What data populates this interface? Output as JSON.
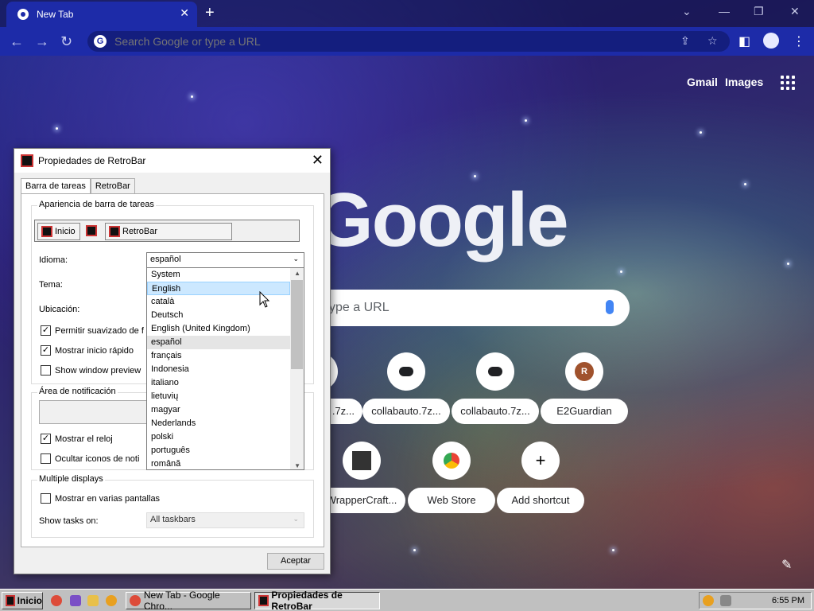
{
  "browser": {
    "tab_title": "New Tab",
    "omnibox_placeholder": "Search Google or type a URL",
    "links": {
      "gmail": "Gmail",
      "images": "Images"
    },
    "logo_text": "Google",
    "search_placeholder": "ype a URL",
    "shortcuts": [
      {
        "label": ".7z...",
        "icon": "cloud-upload-icon"
      },
      {
        "label": "collabauto.7z...",
        "icon": "cloud-upload-icon"
      },
      {
        "label": "collabauto.7z...",
        "icon": "cloud-upload-icon"
      },
      {
        "label": "E2Guardian",
        "icon": "avatar-r",
        "letter": "R"
      },
      {
        "label": "WrapperCraft...",
        "icon": "wrappercraft-icon"
      },
      {
        "label": "Web Store",
        "icon": "webstore-icon"
      },
      {
        "label": "Add shortcut",
        "icon": "plus-icon"
      }
    ]
  },
  "dialog": {
    "title": "Propiedades de RetroBar",
    "tabs": [
      "Barra de tareas",
      "RetroBar"
    ],
    "appearance_group": "Apariencia de barra de tareas",
    "preview": {
      "start": "Inicio",
      "app": "RetroBar"
    },
    "labels": {
      "language": "Idioma:",
      "theme": "Tema:",
      "location": "Ubicación:",
      "smoothing": "Permitir suavizado de f",
      "quick_launch": "Mostrar inicio rápido",
      "window_preview": "Show window preview",
      "notif_group": "Área de notificación",
      "show_clock": "Mostrar el reloj",
      "hide_icons": "Ocultar iconos de noti",
      "multi_group": "Multiple displays",
      "multi_screens": "Mostrar en varias pantallas",
      "show_tasks": "Show tasks on:"
    },
    "checks": {
      "smoothing": true,
      "quick_launch": true,
      "window_preview": false,
      "show_clock": true,
      "hide_icons": false,
      "multi_screens": false
    },
    "language_value": "español",
    "language_options": [
      "System",
      "English",
      "català",
      "Deutsch",
      "English (United Kingdom)",
      "español",
      "français",
      "Indonesia",
      "italiano",
      "lietuvių",
      "magyar",
      "Nederlands",
      "polski",
      "português",
      "română"
    ],
    "hover_index": 1,
    "selected_index": 5,
    "show_tasks_value": "All taskbars",
    "ok": "Aceptar"
  },
  "taskbar": {
    "start": "Inicio",
    "items": [
      {
        "label": "New Tab - Google Chro...",
        "active": false
      },
      {
        "label": "Propiedades de RetroBar",
        "active": true
      }
    ],
    "clock": "6:55 PM"
  }
}
